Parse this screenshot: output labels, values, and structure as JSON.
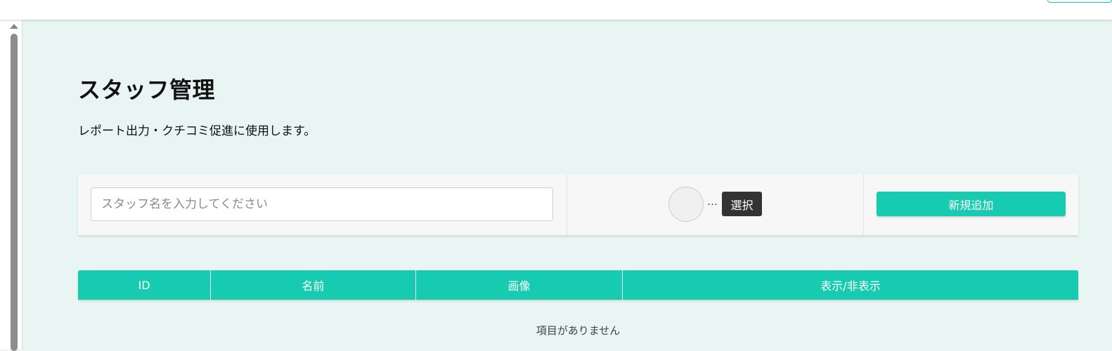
{
  "page": {
    "title": "スタッフ管理",
    "subtitle": "レポート出力・クチコミ促進に使用します。"
  },
  "filters": {
    "search_placeholder": "スタッフ名を入力してください",
    "search_value": "",
    "image_ellipsis": "…",
    "select_label": "選択",
    "add_label": "新規追加"
  },
  "table": {
    "columns": [
      "ID",
      "名前",
      "画像",
      "表示/非表示"
    ],
    "rows": [],
    "empty_message": "項目がありません"
  },
  "colors": {
    "accent": "#17cbb0",
    "background": "#e8f5f3",
    "select_button": "#333333"
  }
}
